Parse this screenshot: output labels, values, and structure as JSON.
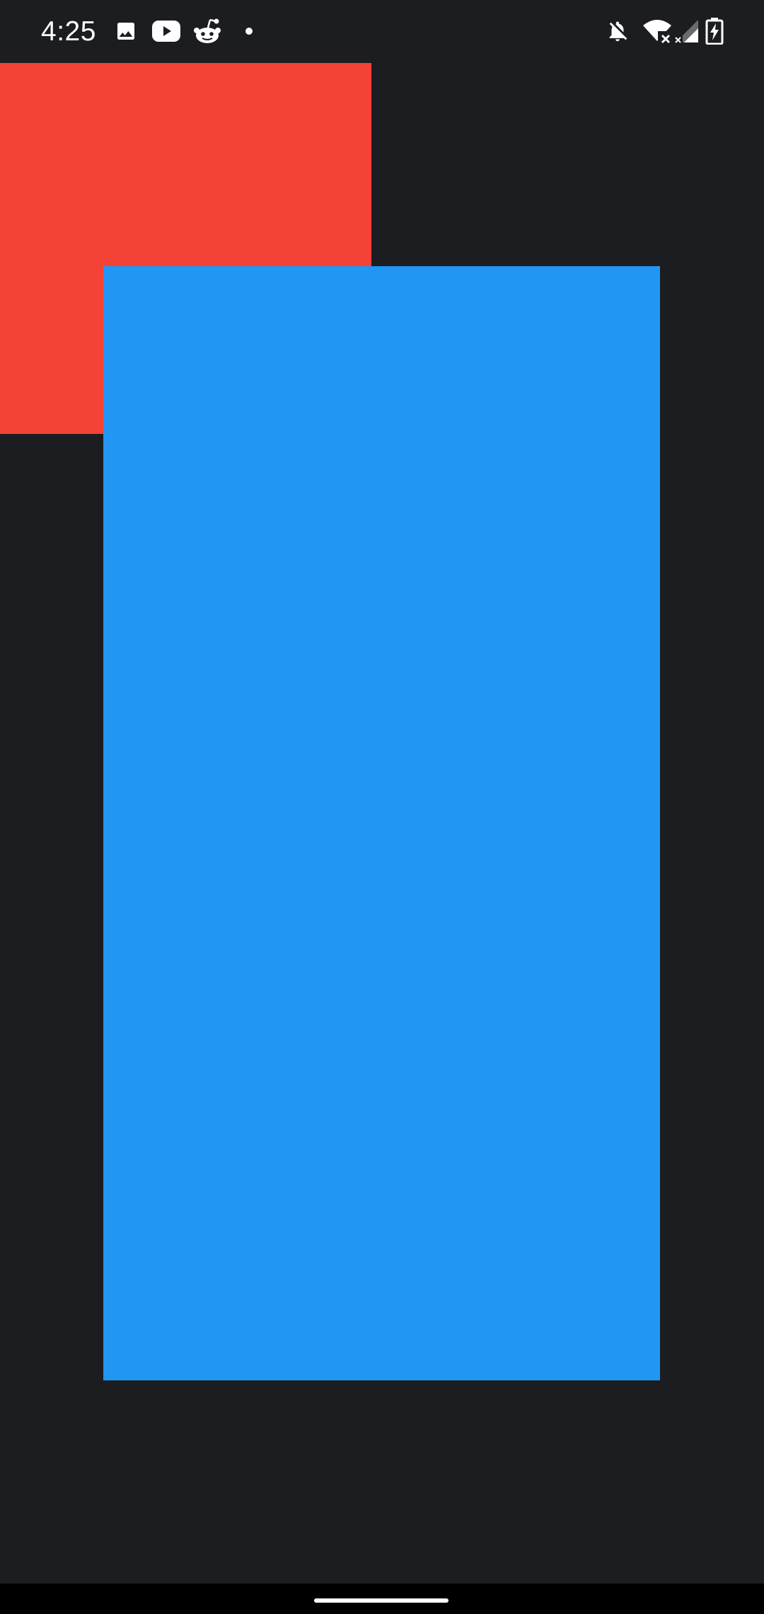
{
  "status_bar": {
    "time": "4:25",
    "left_icons": [
      "image-icon",
      "youtube-icon",
      "reddit-icon",
      "notification-dot-icon"
    ],
    "right_icons": [
      "bell-off-icon",
      "wifi-no-internet-icon",
      "cellular-no-signal-icon",
      "battery-charging-icon"
    ]
  },
  "canvas": {
    "background": "#1c1d20",
    "red_rect_color": "#f44336",
    "blue_rect_color": "#2196f3"
  },
  "nav_bar": {
    "background": "#000000",
    "handle_color": "#ffffff"
  }
}
